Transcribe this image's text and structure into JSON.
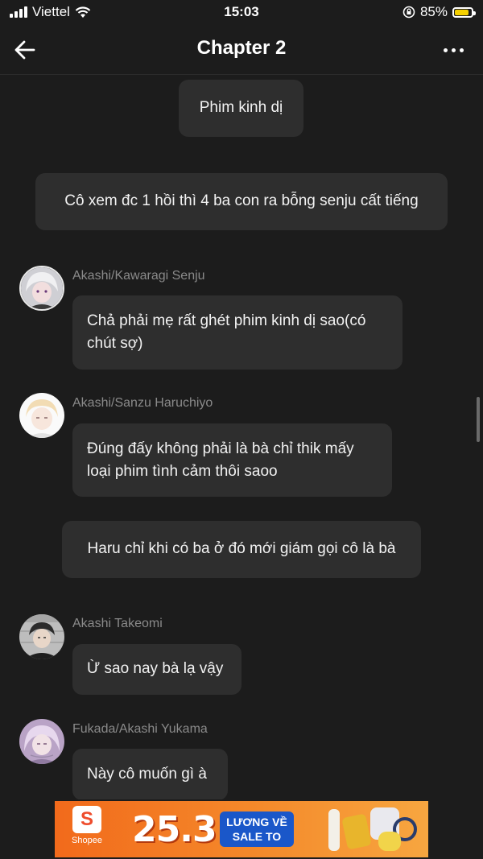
{
  "status_bar": {
    "carrier": "Viettel",
    "time": "15:03",
    "battery": "85%",
    "battery_level": 0.85,
    "battery_color": "#f5d000"
  },
  "header": {
    "title": "Chapter 2",
    "back_icon": "arrow-left-icon",
    "more_icon": "more-horizontal-icon"
  },
  "messages": [
    {
      "type": "narration",
      "text": "Phim kinh dị"
    },
    {
      "type": "narration",
      "text": "Cô xem đc 1 hồi thì 4 ba con ra bỗng senju cất tiếng"
    },
    {
      "type": "character",
      "name": "Akashi/Kawaragi Senju",
      "text": "Chả phải mẹ rất ghét phim kinh dị sao(có chút sợ)"
    },
    {
      "type": "character",
      "name": "Akashi/Sanzu Haruchiyo",
      "text": "Đúng đấy không phải là bà chỉ thik mấy loại phim tình cảm thôi saoo"
    },
    {
      "type": "narration",
      "text": "Haru chỉ khi có ba ở đó mới giám gọi cô là bà"
    },
    {
      "type": "character",
      "name": "Akashi Takeomi",
      "text": "Ừ sao nay bà lạ vậy"
    },
    {
      "type": "character",
      "name": "Fukada/Akashi Yukama",
      "text": "Này cô muốn gì à"
    }
  ],
  "ad": {
    "brand": "Shopee",
    "logo_letter": "S",
    "headline": "25.3",
    "pill_line1": "LƯƠNG VỀ",
    "pill_line2": "SALE TO",
    "accent": "#f26a1b"
  }
}
